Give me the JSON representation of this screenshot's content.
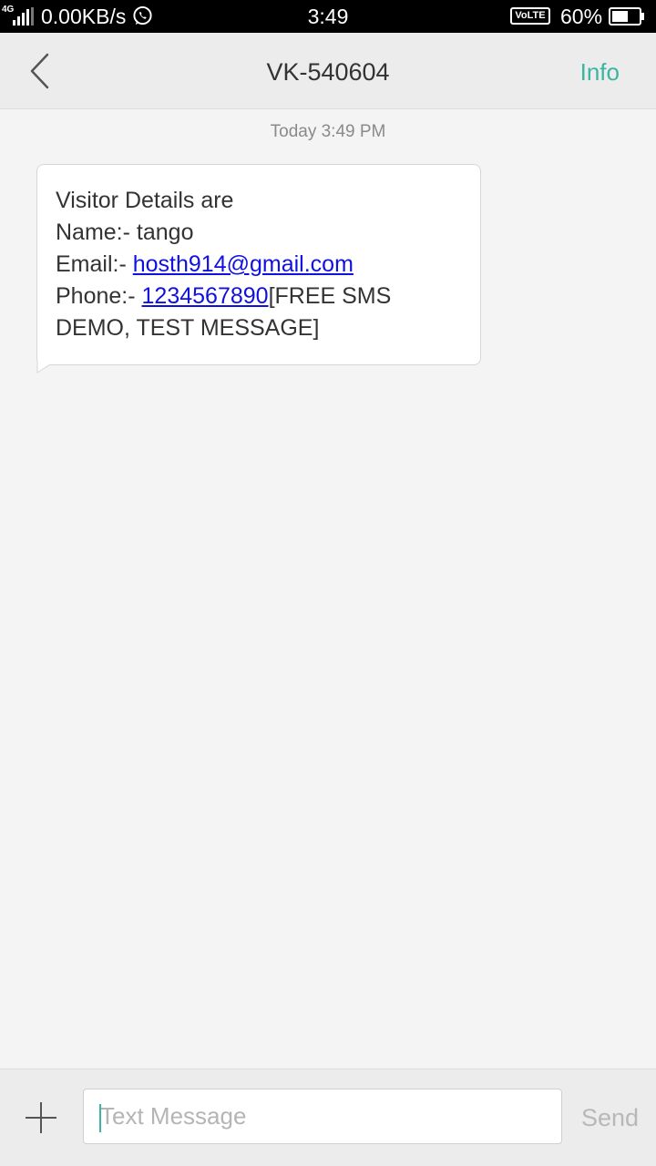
{
  "status_bar": {
    "network_type": "4G",
    "net_speed": "0.00KB/s",
    "time": "3:49",
    "volte_label": "VoLTE",
    "battery_percent": "60%",
    "battery_level": 0.6,
    "notification_icon": "whatsapp-icon"
  },
  "header": {
    "title": "VK-540604",
    "info_label": "Info",
    "back_icon": "chevron-left-icon"
  },
  "conversation": {
    "timestamp": "Today  3:49 PM",
    "message": {
      "line1": "Visitor Details are",
      "name_prefix": "Name:- ",
      "name": "tango",
      "email_prefix": "Email:- ",
      "email": "hosth914@gmail.com",
      "phone_prefix": "Phone:- ",
      "phone": "1234567890",
      "suffix": "[FREE SMS DEMO, TEST MESSAGE]"
    }
  },
  "composer": {
    "placeholder": "Text Message",
    "value": "",
    "send_label": "Send",
    "attach_icon": "plus-icon"
  },
  "colors": {
    "accent": "#3bb4a4",
    "link": "#1010e0",
    "background": "#f4f4f4"
  }
}
